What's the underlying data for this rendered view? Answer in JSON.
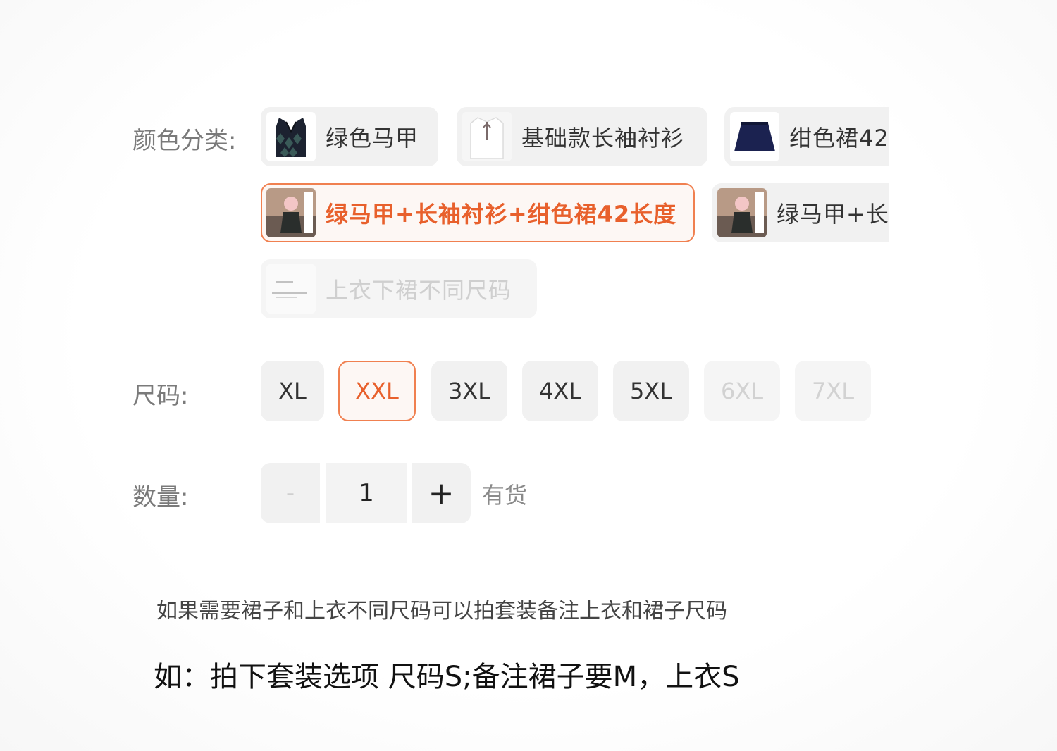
{
  "color_section": {
    "label": "颜色分类:",
    "options": [
      {
        "label": "绿色马甲",
        "thumb": "argyle-vest-thumbnail"
      },
      {
        "label": "基础款长袖衬衫",
        "thumb": "white-shirt-thumbnail"
      },
      {
        "label": "绀色裙42",
        "thumb": "navy-skirt-thumbnail"
      },
      {
        "label": "绿马甲+长袖衬衫+绀色裙42长度",
        "thumb": "outfit-photo-thumbnail"
      },
      {
        "label": "绿马甲+长",
        "thumb": "outfit-photo-thumbnail"
      },
      {
        "label": "上衣下裙不同尺码",
        "thumb": "text-note-thumbnail"
      }
    ],
    "selected": "绿马甲+长袖衬衫+绀色裙42长度"
  },
  "size_section": {
    "label": "尺码:",
    "options": [
      {
        "label": "XL",
        "state": "available"
      },
      {
        "label": "XXL",
        "state": "selected"
      },
      {
        "label": "3XL",
        "state": "available"
      },
      {
        "label": "4XL",
        "state": "available"
      },
      {
        "label": "5XL",
        "state": "available"
      },
      {
        "label": "6XL",
        "state": "disabled"
      },
      {
        "label": "7XL",
        "state": "disabled"
      }
    ]
  },
  "quantity_section": {
    "label": "数量:",
    "minus": "-",
    "value": "1",
    "plus": "+",
    "stock": "有货"
  },
  "notes": {
    "line1": "如果需要裙子和上衣不同尺码可以拍套装备注上衣和裙子尺码",
    "line2": "如：拍下套装选项 尺码S;备注裙子要M，上衣S"
  },
  "colors": {
    "accent": "#e8602c",
    "accent_border": "#f08050",
    "chip_bg": "#f1f1f1"
  }
}
